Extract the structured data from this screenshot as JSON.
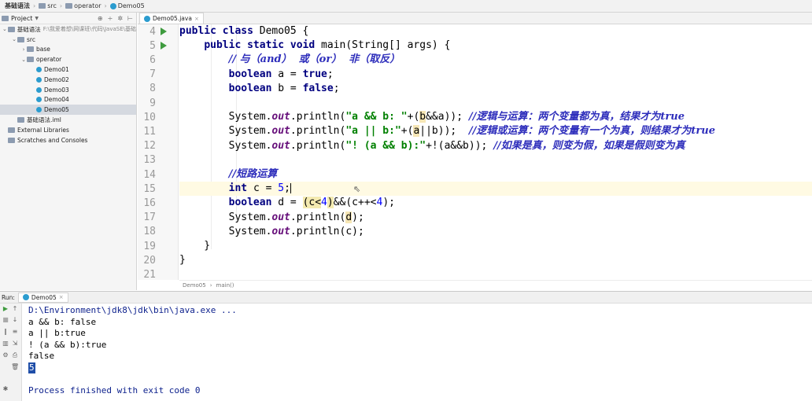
{
  "breadcrumb": {
    "project": "基础语法",
    "src": "src",
    "package": "operator",
    "file": "Demo05"
  },
  "project_panel": {
    "title": "Project",
    "tree": [
      {
        "label": "基础语法",
        "path": "F:\\我爱着想\\网课班\\代码\\JavaSE\\基础",
        "indent": 0,
        "arrow": "v",
        "icon": "module-folder-icon"
      },
      {
        "label": "src",
        "indent": 1,
        "arrow": "v",
        "icon": "source-folder-icon"
      },
      {
        "label": "base",
        "indent": 2,
        "arrow": ">",
        "icon": "package-folder-icon"
      },
      {
        "label": "operator",
        "indent": 2,
        "arrow": "v",
        "icon": "package-folder-icon"
      },
      {
        "label": "Demo01",
        "indent": 3,
        "icon": "java-class-icon"
      },
      {
        "label": "Demo02",
        "indent": 3,
        "icon": "java-class-icon"
      },
      {
        "label": "Demo03",
        "indent": 3,
        "icon": "java-class-icon"
      },
      {
        "label": "Demo04",
        "indent": 3,
        "icon": "java-class-icon"
      },
      {
        "label": "Demo05",
        "indent": 3,
        "icon": "java-class-icon",
        "selected": true
      },
      {
        "label": "基础语法.iml",
        "indent": 1,
        "icon": "iml-file-icon"
      },
      {
        "label": "External Libraries",
        "indent": 0,
        "icon": "library-icon"
      },
      {
        "label": "Scratches and Consoles",
        "indent": 0,
        "icon": "scratch-icon"
      }
    ]
  },
  "editor": {
    "tab_label": "Demo05.java",
    "lines": [
      {
        "n": "4",
        "run": true,
        "tokens": [
          [
            "kw",
            "public class "
          ],
          [
            "",
            "Demo05 {"
          ]
        ]
      },
      {
        "n": "5",
        "run": true,
        "tokens": [
          [
            "",
            "    "
          ],
          [
            "kw",
            "public static void "
          ],
          [
            "",
            "main(String[] args) {"
          ]
        ]
      },
      {
        "n": "6",
        "tokens": [
          [
            "",
            "        "
          ],
          [
            "cm",
            "// 与（and）  或（or）  非（取反）"
          ]
        ]
      },
      {
        "n": "7",
        "tokens": [
          [
            "",
            "        "
          ],
          [
            "kw",
            "boolean "
          ],
          [
            "",
            "a = "
          ],
          [
            "kw",
            "true"
          ],
          [
            "",
            ";"
          ]
        ]
      },
      {
        "n": "8",
        "tokens": [
          [
            "",
            "        "
          ],
          [
            "kw",
            "boolean "
          ],
          [
            "",
            "b = "
          ],
          [
            "kw",
            "false"
          ],
          [
            "",
            ";"
          ]
        ]
      },
      {
        "n": "9",
        "tokens": []
      },
      {
        "n": "10",
        "tokens": [
          [
            "",
            "        System."
          ],
          [
            "fld",
            "out"
          ],
          [
            "",
            ".println("
          ],
          [
            "str",
            "\"a && b: \""
          ],
          [
            "",
            "+("
          ],
          [
            "hl2",
            "b"
          ],
          [
            "",
            "&&a)); "
          ],
          [
            "cm",
            "//逻辑与运算：两个变量都为真，结果才为true"
          ]
        ]
      },
      {
        "n": "11",
        "tokens": [
          [
            "",
            "        System."
          ],
          [
            "fld",
            "out"
          ],
          [
            "",
            ".println("
          ],
          [
            "str",
            "\"a || b:\""
          ],
          [
            "",
            "+("
          ],
          [
            "hl2",
            "a"
          ],
          [
            "",
            "||b));  "
          ],
          [
            "cm",
            "//逻辑或运算：两个变量有一个为真，则结果才为true"
          ]
        ]
      },
      {
        "n": "12",
        "tokens": [
          [
            "",
            "        System."
          ],
          [
            "fld",
            "out"
          ],
          [
            "",
            ".println("
          ],
          [
            "str",
            "\"! (a && b):\""
          ],
          [
            "",
            "+!(a&&b)); "
          ],
          [
            "cm",
            "//如果是真，则变为假，如果是假则变为真"
          ]
        ]
      },
      {
        "n": "13",
        "tokens": []
      },
      {
        "n": "14",
        "tokens": [
          [
            "",
            "        "
          ],
          [
            "cm",
            "//短路运算"
          ]
        ]
      },
      {
        "n": "15",
        "current": true,
        "tokens": [
          [
            "",
            "        "
          ],
          [
            "kw",
            "int "
          ],
          [
            "",
            "c = "
          ],
          [
            "num",
            "5"
          ],
          [
            "",
            ";"
          ],
          [
            "caret",
            ""
          ]
        ]
      },
      {
        "n": "16",
        "tokens": [
          [
            "",
            "        "
          ],
          [
            "kw",
            "boolean "
          ],
          [
            "",
            "d = "
          ],
          [
            "hl",
            "(c<"
          ],
          [
            "num",
            "4"
          ],
          [
            "hl",
            ")"
          ],
          [
            "",
            "&&(c++<"
          ],
          [
            "num",
            "4"
          ],
          [
            "",
            ");"
          ]
        ]
      },
      {
        "n": "17",
        "tokens": [
          [
            "",
            "        System."
          ],
          [
            "fld",
            "out"
          ],
          [
            "",
            ".println("
          ],
          [
            "hl2",
            "d"
          ],
          [
            "",
            ");"
          ]
        ]
      },
      {
        "n": "18",
        "tokens": [
          [
            "",
            "        System."
          ],
          [
            "fld",
            "out"
          ],
          [
            "",
            ".println(c);"
          ]
        ]
      },
      {
        "n": "19",
        "tokens": [
          [
            "",
            "    }"
          ]
        ]
      },
      {
        "n": "20",
        "tokens": [
          [
            "",
            "}"
          ]
        ]
      },
      {
        "n": "21",
        "tokens": []
      }
    ],
    "breadcrumb": [
      "Demo05",
      "main()"
    ]
  },
  "run": {
    "label": "Run:",
    "tab_label": "Demo05",
    "console": [
      {
        "text": "D:\\Environment\\jdk8\\jdk\\bin\\java.exe ...",
        "kind": "cmd"
      },
      {
        "text": "a && b: false"
      },
      {
        "text": "a || b:true"
      },
      {
        "text": "! (a && b):true"
      },
      {
        "text": "false"
      },
      {
        "text": "5",
        "kind": "sel"
      },
      {
        "text": ""
      },
      {
        "text": "Process finished with exit code 0",
        "kind": "cmd"
      }
    ]
  }
}
